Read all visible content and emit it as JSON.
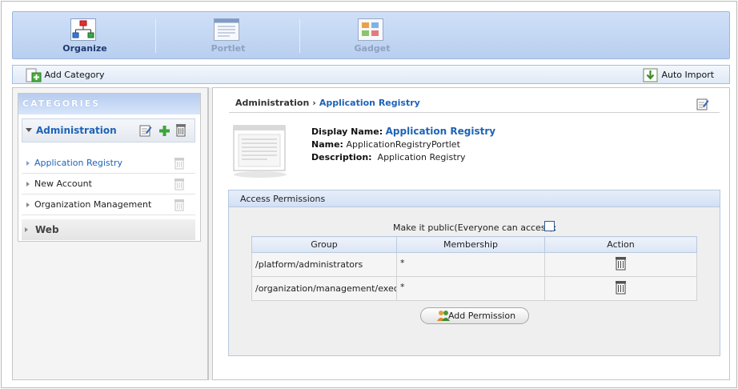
{
  "tabs": [
    {
      "label": "Organize",
      "state": "active",
      "icon": "organize-icon"
    },
    {
      "label": "Portlet",
      "state": "inactive",
      "icon": "portlet-icon"
    },
    {
      "label": "Gadget",
      "state": "inactive",
      "icon": "gadget-icon"
    }
  ],
  "actionbar": {
    "add_category": "Add Category",
    "auto_import": "Auto Import"
  },
  "categories": {
    "header": "CATEGORIES",
    "administration": {
      "name": "Administration",
      "items": [
        "Application Registry",
        "New Account",
        "Organization Management"
      ],
      "selected": "Application Registry"
    },
    "web": {
      "name": "Web"
    }
  },
  "breadcrumb": {
    "root": "Administration",
    "separator": "›",
    "current": "Application Registry"
  },
  "details": {
    "display_name_label": "Display Name:",
    "display_name": "Application Registry",
    "name_label": "Name:",
    "name": "ApplicationRegistryPortlet",
    "description_label": "Description:",
    "description": "Application Registry"
  },
  "permissions": {
    "title": "Access Permissions",
    "public_label": "Make it public(Everyone can access):",
    "public_checked": false,
    "columns": [
      "Group",
      "Membership",
      "Action"
    ],
    "rows": [
      {
        "group": "/platform/administrators",
        "membership": "*"
      },
      {
        "group": "/organization/management/executive-board",
        "membership": "*"
      }
    ],
    "add_button": "Add Permission"
  },
  "colors": {
    "accent_link": "#1e63b7",
    "tab_bar": "#c4d8f5"
  }
}
